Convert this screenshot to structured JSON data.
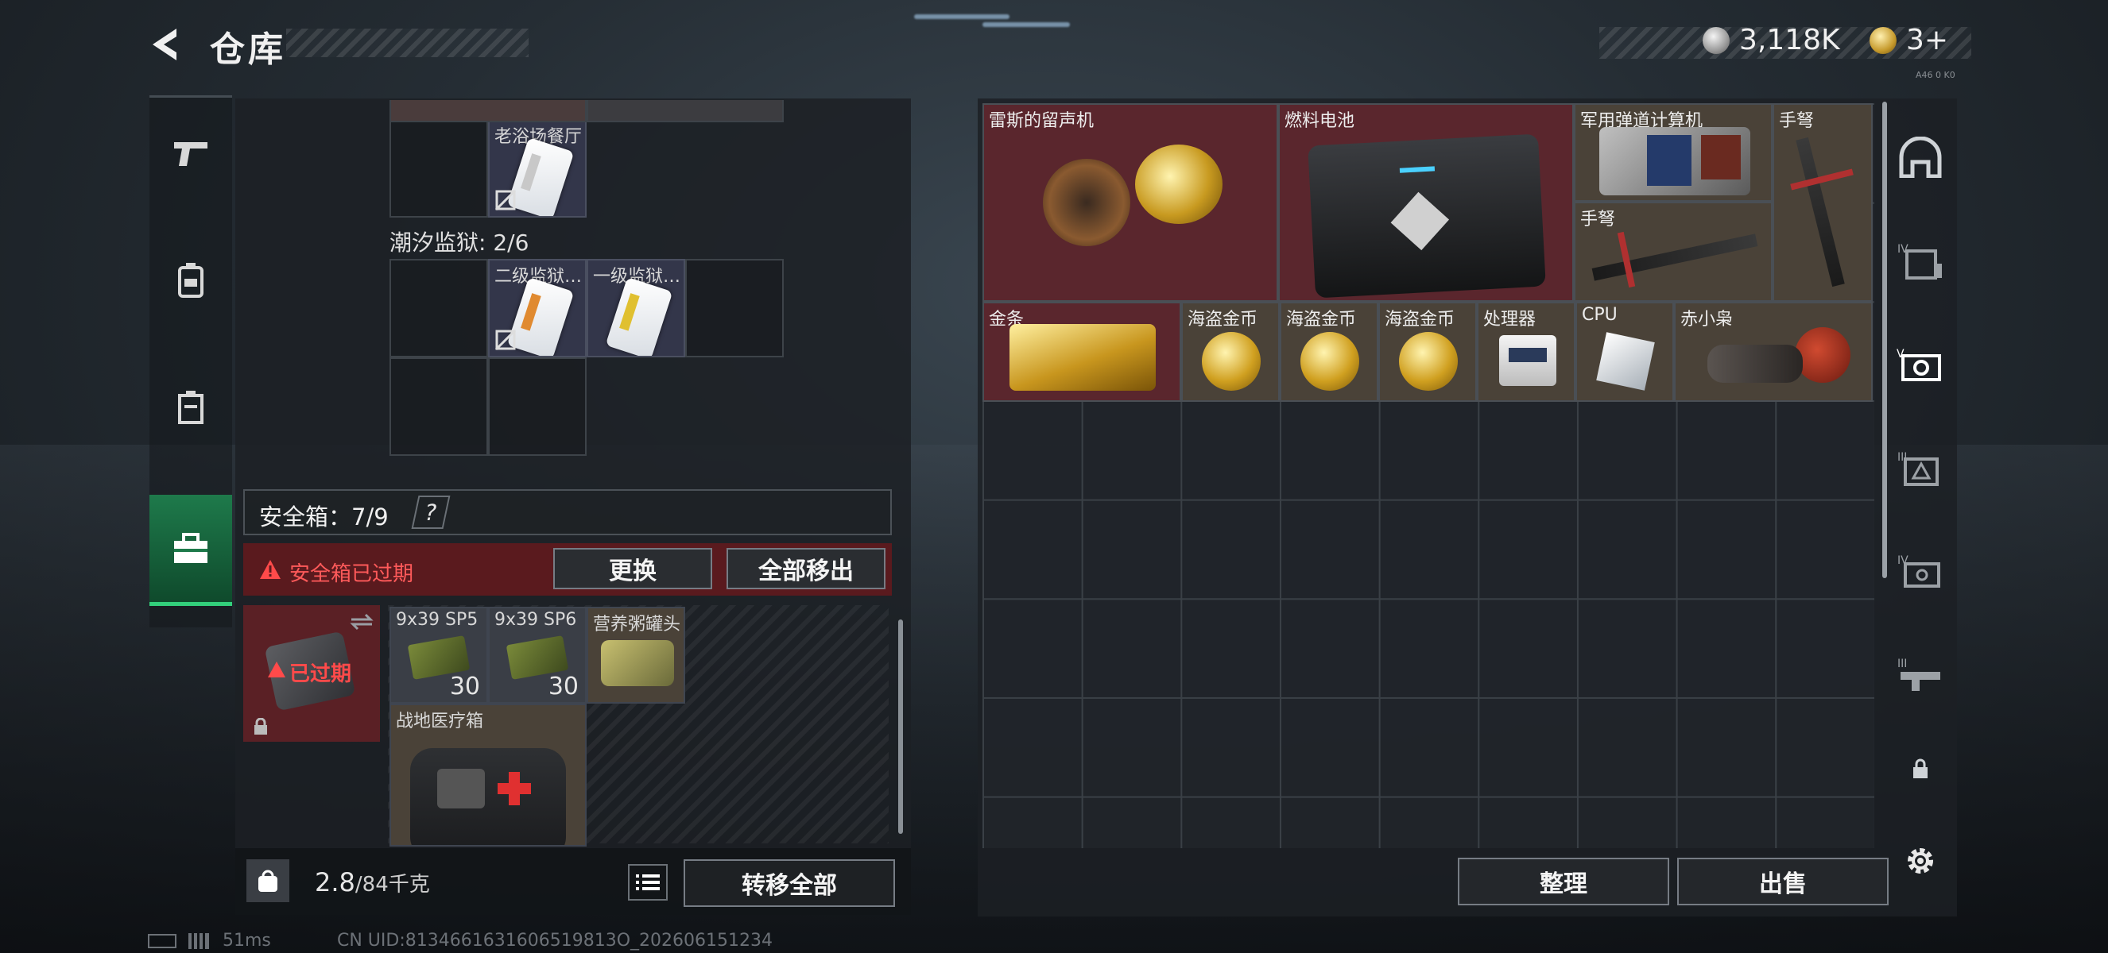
{
  "header": {
    "title": "仓库",
    "silver_amount": "3,118K",
    "gold_amount": "3+",
    "corner_code": "A46 0 K0"
  },
  "left_sidebar": {
    "items": [
      {
        "name": "weapons",
        "icon": "pistol-icon"
      },
      {
        "name": "equipment",
        "icon": "backpack-icon"
      },
      {
        "name": "container",
        "icon": "case-icon"
      },
      {
        "name": "safebox",
        "icon": "toolbox-icon",
        "active": true
      }
    ]
  },
  "left_panel": {
    "top_item_label": "老浴场餐厅",
    "prison_section": "潮汐监狱: 2/6",
    "prison_items": [
      "二级监狱…",
      "一级监狱…"
    ]
  },
  "safe_box": {
    "title": "安全箱：7/9",
    "help": "?",
    "expired_message": "安全箱已过期",
    "replace_button": "更换",
    "remove_all_button": "全部移出",
    "case_status": "已过期",
    "items": [
      {
        "label": "9x39 SP5",
        "count": "30"
      },
      {
        "label": "9x39 SP6",
        "count": "30"
      },
      {
        "label": "营养粥罐头",
        "count": ""
      },
      {
        "label": "战地医疗箱",
        "count": ""
      }
    ]
  },
  "bottom_left": {
    "weight_value": "2.8",
    "weight_total": "/84千克",
    "transfer_all_button": "转移全部"
  },
  "storage": {
    "items": [
      {
        "label": "雷斯的留声机",
        "rarity": "red"
      },
      {
        "label": "燃料电池",
        "rarity": "red"
      },
      {
        "label": "军用弹道计算机",
        "rarity": "tan"
      },
      {
        "label": "手弩",
        "rarity": "tan"
      },
      {
        "label": "手弩",
        "rarity": "tan"
      },
      {
        "label": "金条",
        "rarity": "red"
      },
      {
        "label": "海盗金币",
        "rarity": "tan"
      },
      {
        "label": "海盗金币",
        "rarity": "tan"
      },
      {
        "label": "海盗金币",
        "rarity": "tan"
      },
      {
        "label": "处理器",
        "rarity": "tan"
      },
      {
        "label": "CPU",
        "rarity": "tan"
      },
      {
        "label": "赤小枭",
        "rarity": "tan"
      }
    ],
    "sort_button": "整理",
    "sell_button": "出售"
  },
  "right_sidebar": {
    "items": [
      "helmet-icon",
      "tier4-vest-icon",
      "tier5-case-icon",
      "tier3-case-icon",
      "tier4-case-icon",
      "tier3-rifle-icon",
      "lock-icon"
    ]
  },
  "status": {
    "ping": "51ms",
    "uid": "CN UID:8134661631606519813O_202606151234"
  },
  "colors": {
    "red_rarity": "#5a262d",
    "tan_rarity": "#4a4238",
    "active_tab": "#1e7a4b",
    "warning_red": "#ff5a5a"
  }
}
